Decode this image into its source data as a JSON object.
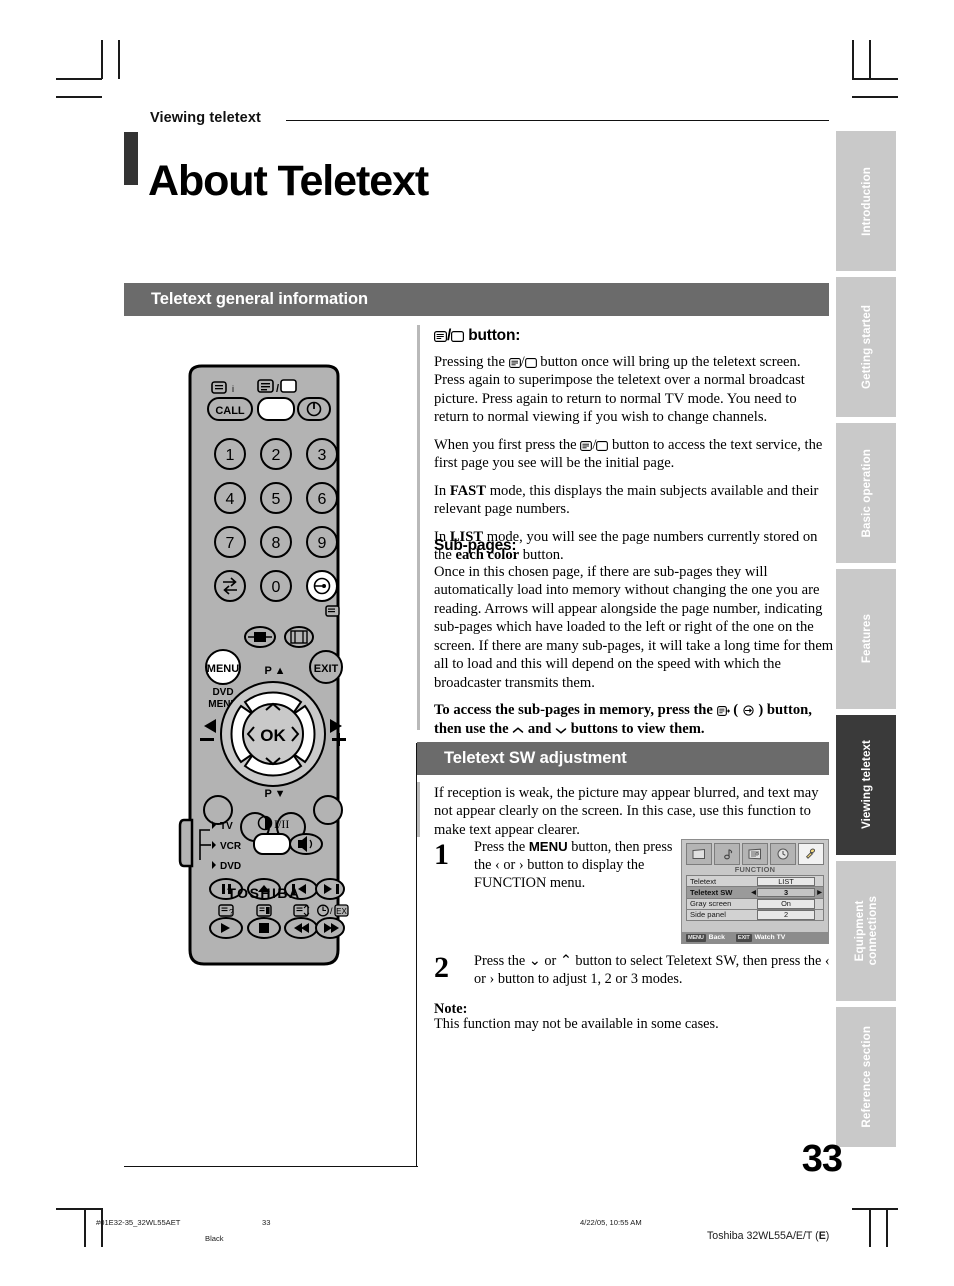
{
  "header": {
    "kicker": "Viewing teletext",
    "title": "About Teletext"
  },
  "sections": {
    "general": "Teletext general information",
    "sw": "Teletext SW adjustment"
  },
  "general": {
    "heading_suffix": "button:",
    "p1": "Pressing the ⓘ/⎕ button once will bring up the teletext screen. Press again to superimpose the teletext over a normal broadcast picture. Press again to return to normal TV mode. You need to return to normal viewing if you wish to change channels.",
    "p1_a": "Pressing the ",
    "p1_b": " button once will bring up the teletext screen. Press again to superimpose the teletext over a normal broadcast picture. Press again to return to normal TV mode. You need to return to normal viewing if you wish to change channels.",
    "p2_a": "When you first press the ",
    "p2_b": " button to access the text service, the first page you see will be the initial page.",
    "p3_a": "In ",
    "p3_bold": "FAST",
    "p3_b": " mode, this displays the main subjects available and their relevant page numbers.",
    "p4_a": "In ",
    "p4_bold": "LIST",
    "p4_b": " mode, you will see the page numbers currently stored on the ",
    "p4_bold2": "each color",
    "p4_c": " button."
  },
  "subpages": {
    "heading": "Sub-pages:",
    "p1": "Once in this chosen page, if there are sub-pages they will automatically load into memory without changing the one you are reading. Arrows will appear alongside the page number, indicating sub-pages which have loaded to the left or right of the one on the screen. If there are many sub-pages, it will take a long time for them all to load and this will depend on the speed with which the broadcaster transmits them.",
    "p2_a": "To access the sub-pages in memory, press the ",
    "p2_b": " ( ",
    "p2_c": " ) button, then use the ",
    "p2_d": " and ",
    "p2_e": " buttons to view them."
  },
  "sw": {
    "intro": "If reception is weak, the picture may appear blurred, and text may not appear clearly on the screen. In this case, use this function to make text appear clearer.",
    "step1_num": "1",
    "step1_a": "Press the ",
    "step1_bold": "MENU",
    "step1_b": " button, then press the ‹ or › button to display the FUNCTION menu.",
    "step2_num": "2",
    "step2_a": "Press the ⌄ or ⌃ button to select Teletext SW, then press the ‹ or › button to adjust 1, 2 or 3 modes.",
    "note_label": "Note:",
    "note_text": "This function may not be available in some cases."
  },
  "osd": {
    "title": "FUNCTION",
    "icons": [
      "picture-icon",
      "audio-icon",
      "setup-icon",
      "timer-icon",
      "function-icon"
    ],
    "active_icon_index": 4,
    "rows": [
      {
        "label": "Teletext",
        "value": "LIST",
        "selected": false,
        "arrows": false
      },
      {
        "label": "Teletext SW",
        "value": "3",
        "selected": true,
        "arrows": true
      },
      {
        "label": "Gray screen",
        "value": "On",
        "selected": false,
        "arrows": false
      },
      {
        "label": "Side panel",
        "value": "2",
        "selected": false,
        "arrows": false
      }
    ],
    "foot": {
      "menu_key": "MENU",
      "menu_action": "Back",
      "exit_key": "EXIT",
      "exit_action": "Watch TV"
    }
  },
  "rail": {
    "tabs": [
      {
        "label": "Introduction",
        "active": false
      },
      {
        "label": "Getting started",
        "active": false
      },
      {
        "label": "Basic operation",
        "active": false
      },
      {
        "label": "Features",
        "active": false
      },
      {
        "label": "Viewing teletext",
        "active": true
      },
      {
        "label": "Equipment\nconnections",
        "active": false
      },
      {
        "label": "Reference section",
        "active": false
      }
    ]
  },
  "page_number": "33",
  "footer": {
    "file": "#01E32-35_32WL55AET",
    "page": "33",
    "ink": "Black",
    "date": "4/22/05, 10:55 AM",
    "model_a": "Toshiba 32WL55A/E/T (",
    "model_b": "E",
    "model_c": ")"
  },
  "remote": {
    "brand": "TOSHIBA",
    "call_label": "CALL",
    "numbers": [
      "1",
      "2",
      "3",
      "4",
      "5",
      "6",
      "7",
      "8",
      "9",
      "0"
    ],
    "menu_label": "MENU",
    "dvd_menu_line1": "DVD",
    "dvd_menu_line2": "MENU",
    "exit_label": "EXIT",
    "ok_label": "OK",
    "p_up": "P",
    "p_down": "P",
    "mode_tv": "TV",
    "mode_vcr": "VCR",
    "mode_dvd": "DVD",
    "sound_label": "I/II"
  },
  "colors": {
    "section_bar": "#6b6b6b",
    "rail_inactive": "#c9c9c9",
    "rail_active": "#3a3a3a",
    "remote_body": "#b3b3b3"
  }
}
